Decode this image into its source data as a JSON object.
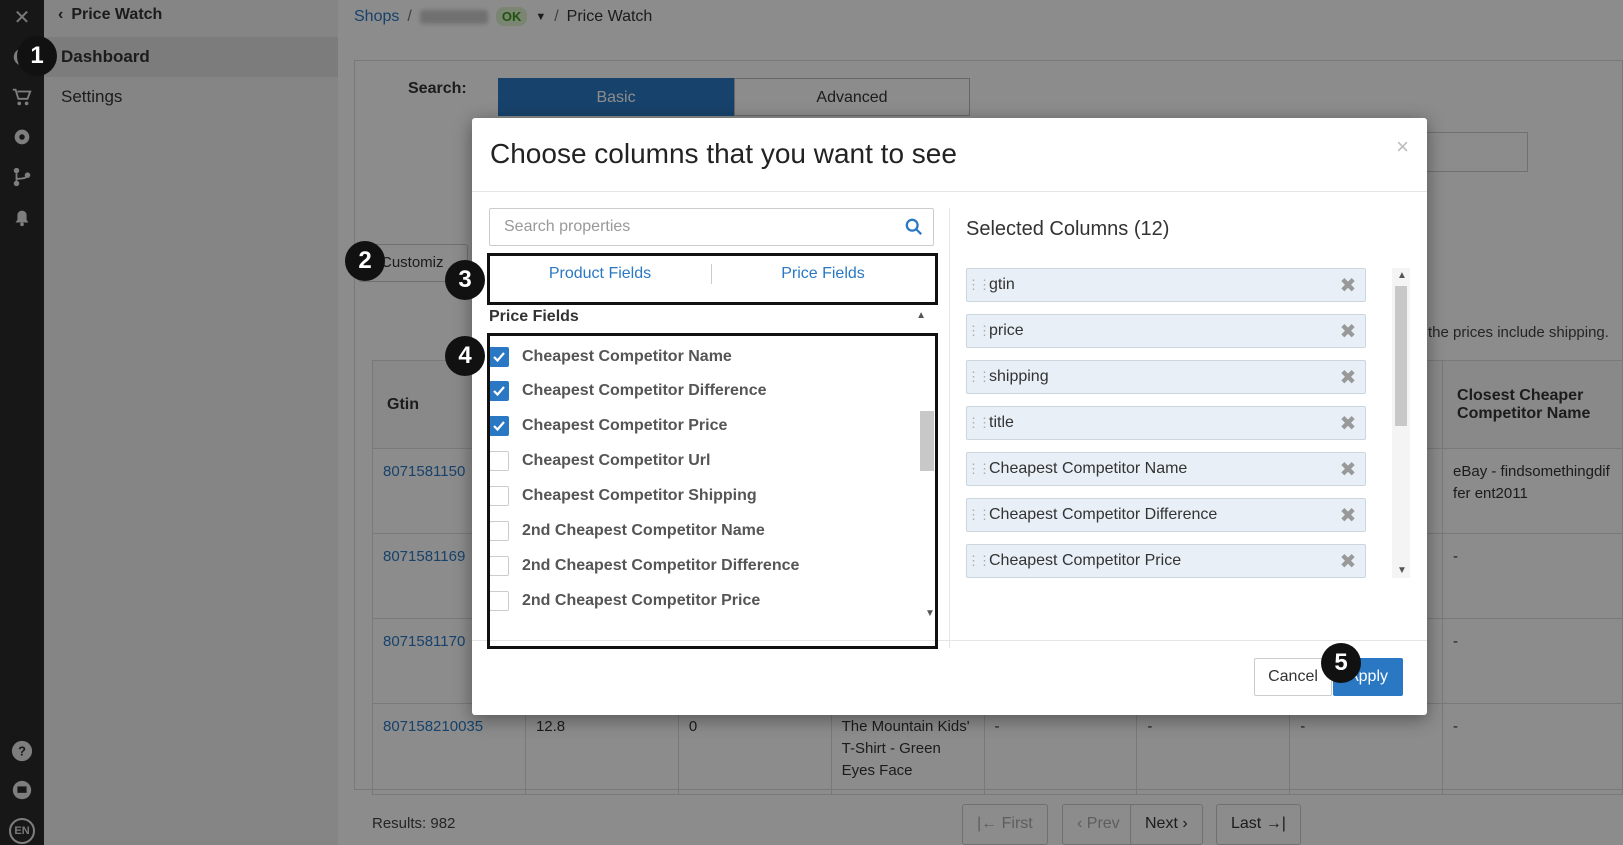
{
  "iconbar": {
    "close": "✕",
    "lang": "EN"
  },
  "sidenav": {
    "back_label": "Price Watch",
    "items": [
      {
        "label": "Dashboard",
        "active": true
      },
      {
        "label": "Settings",
        "active": false
      }
    ]
  },
  "breadcrumb": {
    "shops": "Shops",
    "status": "OK",
    "current": "Price Watch"
  },
  "search": {
    "label": "Search:",
    "tabs": [
      "Basic",
      "Advanced"
    ],
    "active_tab": "Basic"
  },
  "customize_label": "Customiz",
  "shipping_note": "the prices include shipping.",
  "table": {
    "headers": [
      "Gtin",
      "",
      "",
      "",
      "",
      "",
      "",
      "Closest Cheaper Competitor Name"
    ],
    "rows": [
      [
        "8071581150",
        "",
        "",
        "",
        "",
        "",
        "",
        "eBay - findsomethingdiffer ent2011"
      ],
      [
        "8071581169",
        "",
        "",
        "",
        "",
        "",
        "",
        "-"
      ],
      [
        "8071581170",
        "",
        "",
        "",
        "",
        "",
        "",
        "-"
      ],
      [
        "807158210035",
        "12.8",
        "0",
        "The Mountain Kids' T-Shirt - Green Eyes Face",
        "-",
        "-",
        "-",
        "-"
      ]
    ]
  },
  "footer": {
    "results": "Results: 982",
    "pagination": [
      "First",
      "Prev",
      "Next",
      "Last"
    ]
  },
  "modal": {
    "title": "Choose columns that you want to see",
    "close": "×",
    "search_placeholder": "Search properties",
    "tabs": [
      "Product Fields",
      "Price Fields"
    ],
    "section_title": "Price Fields",
    "fields": [
      {
        "label": "Cheapest Competitor Name",
        "checked": true
      },
      {
        "label": "Cheapest Competitor Difference",
        "checked": true
      },
      {
        "label": "Cheapest Competitor Price",
        "checked": true
      },
      {
        "label": "Cheapest Competitor Url",
        "checked": false
      },
      {
        "label": "Cheapest Competitor Shipping",
        "checked": false
      },
      {
        "label": "2nd Cheapest Competitor Name",
        "checked": false
      },
      {
        "label": "2nd Cheapest Competitor Difference",
        "checked": false
      },
      {
        "label": "2nd Cheapest Competitor Price",
        "checked": false
      }
    ],
    "selected_title": "Selected Columns (12)",
    "selected": [
      "gtin",
      "price",
      "shipping",
      "title",
      "Cheapest Competitor Name",
      "Cheapest Competitor Difference",
      "Cheapest Competitor Price"
    ],
    "cancel_label": "Cancel",
    "apply_label": "Apply"
  },
  "annotations": [
    "1",
    "2",
    "3",
    "4",
    "5"
  ],
  "colors": {
    "accent": "#2a78c3",
    "iconbar": "#2b2b2b",
    "ok": "#3a9a1b"
  }
}
